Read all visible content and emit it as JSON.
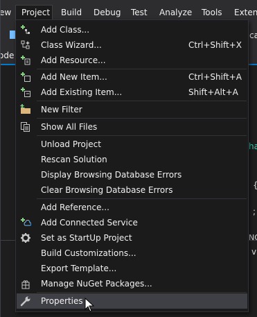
{
  "menubar": {
    "items": [
      {
        "label": "ew"
      },
      {
        "label": "Project"
      },
      {
        "label": "Build"
      },
      {
        "label": "Debug"
      },
      {
        "label": "Test"
      },
      {
        "label": "Analyze"
      },
      {
        "label": "Tools"
      },
      {
        "label": "Extens"
      }
    ]
  },
  "background": {
    "toolbar_fragment": "ca",
    "tab_fragment": "ode",
    "code_fragments": [
      "ha",
      "{",
      ";",
      "NO",
      "v"
    ]
  },
  "menu": {
    "items": [
      {
        "label": "Add Class...",
        "shortcut": "",
        "icon": "add-class-icon"
      },
      {
        "label": "Class Wizard...",
        "shortcut": "Ctrl+Shift+X",
        "icon": "class-wizard-icon"
      },
      {
        "label": "Add Resource...",
        "shortcut": "",
        "icon": "add-resource-icon"
      },
      {
        "label": "Add New Item...",
        "shortcut": "Ctrl+Shift+A",
        "icon": "new-item-icon"
      },
      {
        "label": "Add Existing Item...",
        "shortcut": "Shift+Alt+A",
        "icon": "existing-item-icon"
      },
      {
        "label": "New Filter",
        "shortcut": "",
        "icon": "new-filter-icon"
      },
      {
        "label": "Show All Files",
        "shortcut": "",
        "icon": "show-all-files-icon"
      },
      {
        "label": "Unload Project",
        "shortcut": "",
        "icon": ""
      },
      {
        "label": "Rescan Solution",
        "shortcut": "",
        "icon": ""
      },
      {
        "label": "Display Browsing Database Errors",
        "shortcut": "",
        "icon": ""
      },
      {
        "label": "Clear Browsing Database Errors",
        "shortcut": "",
        "icon": ""
      },
      {
        "label": "Add Reference...",
        "shortcut": "",
        "icon": ""
      },
      {
        "label": "Add Connected Service",
        "shortcut": "",
        "icon": "connected-service-icon"
      },
      {
        "label": "Set as StartUp Project",
        "shortcut": "",
        "icon": "gear-icon"
      },
      {
        "label": "Build Customizations...",
        "shortcut": "",
        "icon": ""
      },
      {
        "label": "Export Template...",
        "shortcut": "",
        "icon": ""
      },
      {
        "label": "Manage NuGet Packages...",
        "shortcut": "",
        "icon": "nuget-icon"
      },
      {
        "label": "Properties",
        "shortcut": "",
        "icon": "wrench-icon"
      }
    ]
  },
  "colors": {
    "accent_green": "#89d185",
    "accent_blue": "#75beff",
    "folder_yellow": "#dcb67a",
    "highlight": "#3f3f46"
  }
}
